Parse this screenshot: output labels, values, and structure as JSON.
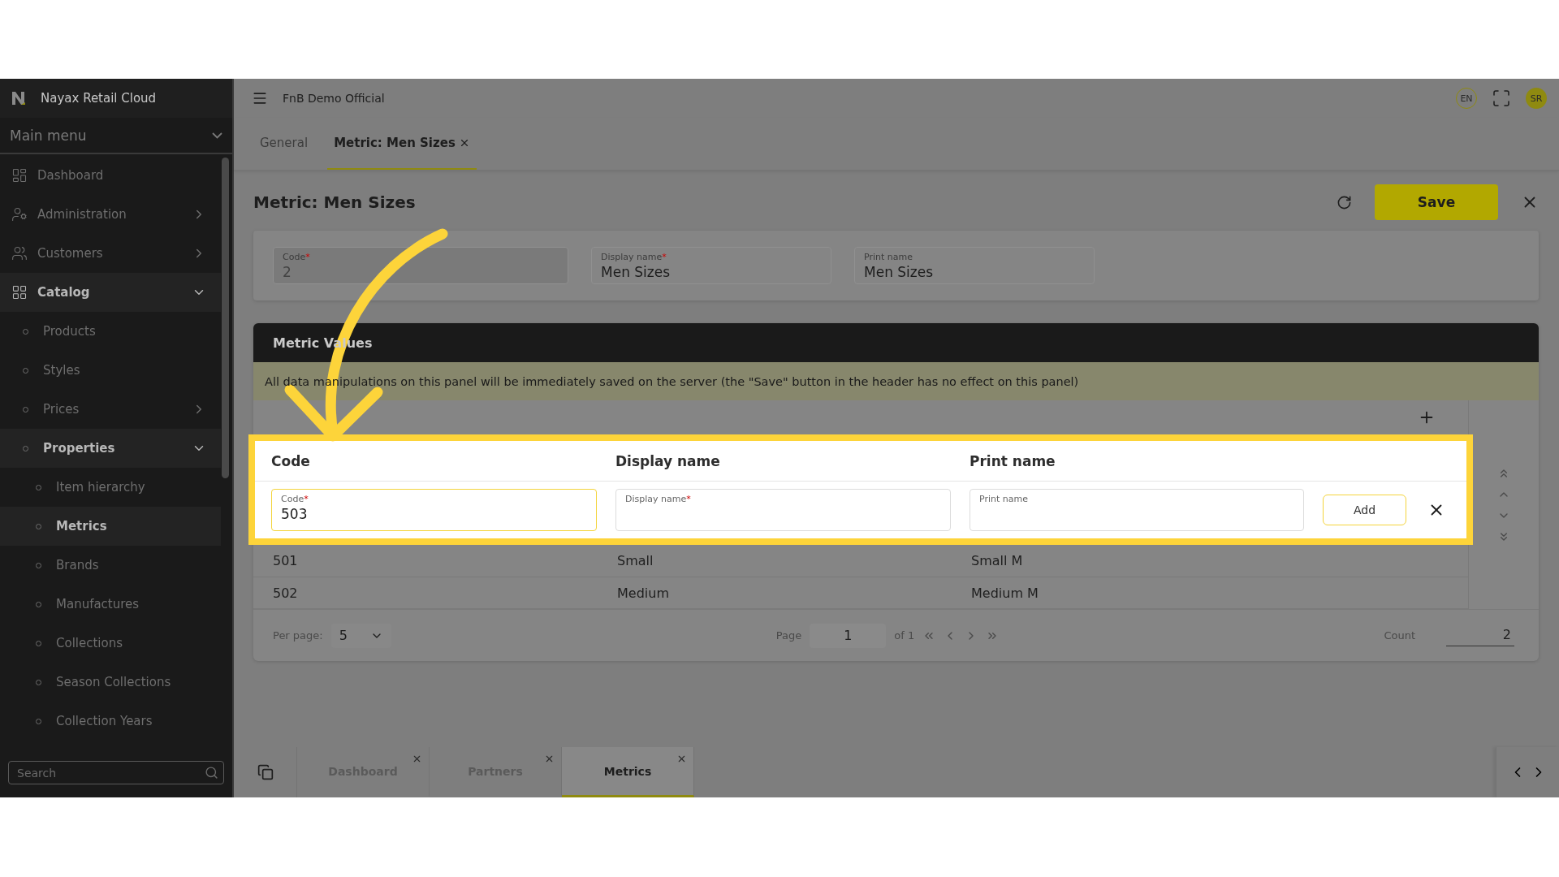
{
  "sidebar": {
    "brand": "Nayax Retail Cloud",
    "menu_title": "Main menu",
    "items": [
      {
        "label": "Dashboard",
        "selected": false
      },
      {
        "label": "Administration",
        "expanded": false
      },
      {
        "label": "Customers",
        "expanded": false
      },
      {
        "label": "Catalog",
        "expanded": true,
        "children": [
          {
            "label": "Products",
            "selected": false
          },
          {
            "label": "Styles",
            "selected": false
          },
          {
            "label": "Prices",
            "expanded": false
          },
          {
            "label": "Properties",
            "expanded": true,
            "children": [
              {
                "label": "Item hierarchy",
                "selected": false
              },
              {
                "label": "Metrics",
                "selected": true
              },
              {
                "label": "Brands",
                "selected": false
              },
              {
                "label": "Manufactures",
                "selected": false
              },
              {
                "label": "Collections",
                "selected": false
              },
              {
                "label": "Season Collections",
                "selected": false
              },
              {
                "label": "Collection Years",
                "selected": false
              }
            ]
          }
        ]
      }
    ],
    "search": {
      "placeholder": "Search"
    }
  },
  "topbar": {
    "organization": "FnB Demo Official",
    "language": "EN",
    "avatar": "SR"
  },
  "tabs": [
    {
      "label": "General",
      "selected": false
    },
    {
      "label": "Metric: Men Sizes",
      "selected": true
    }
  ],
  "form": {
    "title": "Metric: Men Sizes",
    "save": "Save",
    "fields": [
      {
        "label": "Code",
        "mark": "*",
        "value": "2",
        "disabled": true
      },
      {
        "label": "Display name",
        "mark": "*",
        "value": "Men Sizes",
        "disabled": false
      },
      {
        "label": "Print name",
        "value": "Men Sizes",
        "disabled": false
      }
    ]
  },
  "panel": {
    "title": "Metric Values",
    "notice": "All data manipulations on this panel will be immediately saved on the server (the \"Save\" button in the header has no effect on this panel)",
    "columns": [
      "Code",
      "Display name",
      "Print name"
    ],
    "new_row": {
      "fields": [
        {
          "label": "Code",
          "mark": "*",
          "value": "503",
          "focused": true
        },
        {
          "label": "Display name",
          "mark": "*",
          "focused": false
        },
        {
          "label": "Print name",
          "focused": false
        }
      ],
      "add": "Add"
    },
    "rows": [
      [
        "501",
        "Small",
        "Small M"
      ],
      [
        "502",
        "Medium",
        "Medium M"
      ]
    ],
    "pagination": {
      "per_page_label": "Per page:",
      "per_page": "5",
      "page_label": "Page",
      "page": "1",
      "of": "of 1",
      "count_label": "Count",
      "count": "2"
    }
  },
  "bottom_tabs": [
    {
      "label": "Dashboard",
      "selected": false
    },
    {
      "label": "Partners",
      "selected": false
    },
    {
      "label": "Metrics",
      "selected": true
    }
  ]
}
